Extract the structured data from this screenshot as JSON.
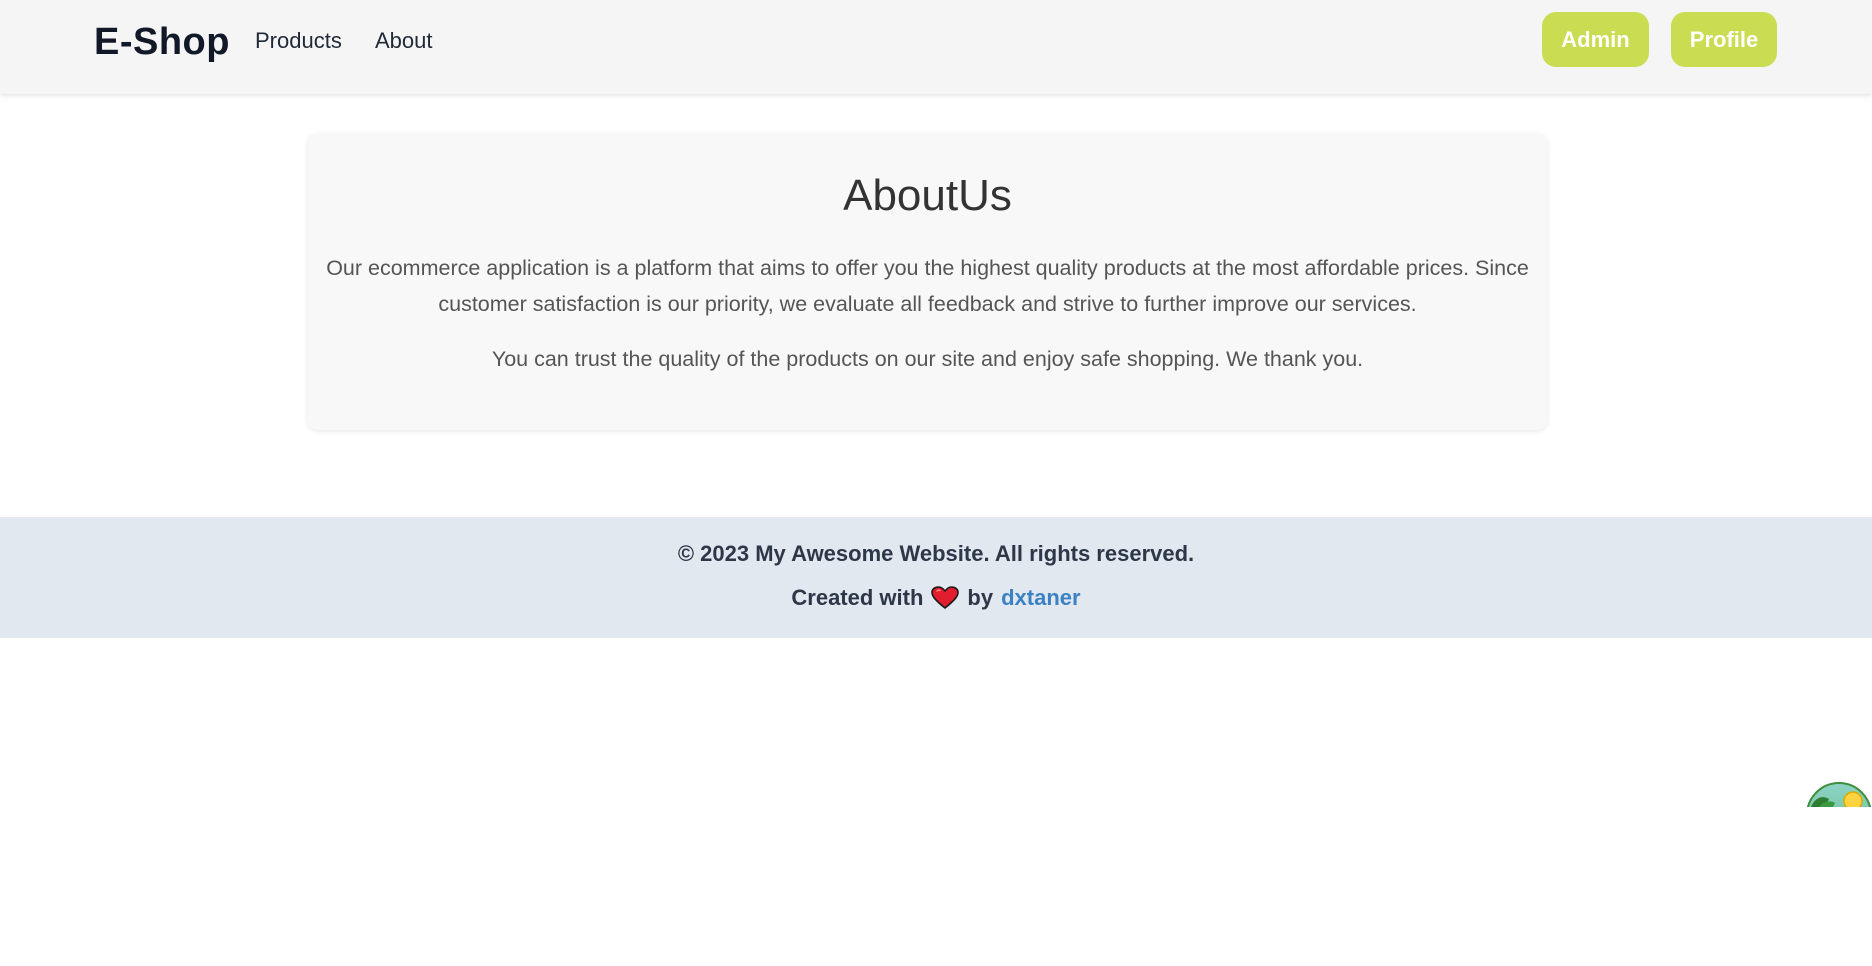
{
  "header": {
    "brand": "E-Shop",
    "nav": {
      "products": "Products",
      "about": "About"
    },
    "buttons": {
      "admin": "Admin",
      "profile": "Profile"
    }
  },
  "about": {
    "title": "AboutUs",
    "paragraph1": "Our ecommerce application is a platform that aims to offer you the highest quality products at the most affordable prices. Since customer satisfaction is our priority, we evaluate all feedback and strive to further improve our services.",
    "paragraph2": "You can trust the quality of the products on our site and enjoy safe shopping. We thank you."
  },
  "footer": {
    "copyright": "© 2023 My Awesome Website. All rights reserved.",
    "created_with": "Created with",
    "by": "by",
    "author": "dxtaner"
  },
  "icons": {
    "heart": "heart-icon",
    "widget": "beach-sun-icon"
  },
  "colors": {
    "accent_button": "#c9dc52",
    "footer_bg": "#e2e8f0",
    "author_link": "#3b82c4",
    "heart": "#e11d2e"
  }
}
